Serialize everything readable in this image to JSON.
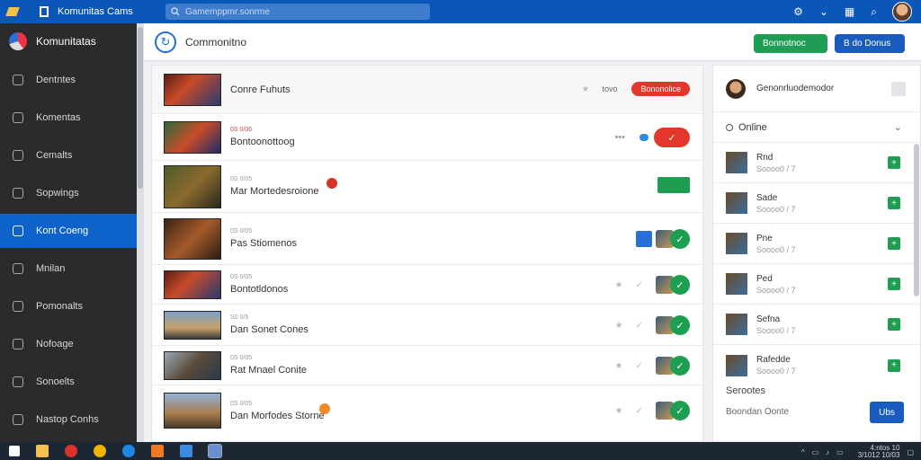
{
  "topbar": {
    "title": "Komunitas Cams",
    "search_placeholder": "Gamemppmr.sonrme",
    "accent": "#0b57b8"
  },
  "sidebar": {
    "header": "Komunitatas",
    "items": [
      {
        "label": "Dentntes",
        "icon": "home-icon"
      },
      {
        "label": "Komentas",
        "icon": "chat-icon"
      },
      {
        "label": "Cemalts",
        "icon": "calendar-icon"
      },
      {
        "label": "Sopwings",
        "icon": "folder-icon"
      },
      {
        "label": "Kont Coeng",
        "icon": "game-icon",
        "active": true
      },
      {
        "label": "Mnilan",
        "icon": "list-icon"
      },
      {
        "label": "Pomonalts",
        "icon": "user-icon"
      },
      {
        "label": "Nofoage",
        "icon": "bookmark-icon"
      },
      {
        "label": "Sonoelts",
        "icon": "search-icon"
      },
      {
        "label": "Nastop Conhs",
        "icon": "globe-icon"
      }
    ]
  },
  "header": {
    "title": "Commonitno",
    "btn_green": "Bonnotnoc",
    "btn_blue": "B do Donus"
  },
  "rows": [
    {
      "meta": "",
      "title": "Conre Fuhuts",
      "action": "Bononolice",
      "action_extra": "tovo"
    },
    {
      "meta": "0S 0/06",
      "title": "Bontoonottoog",
      "action": ""
    },
    {
      "meta": "0S 0/05",
      "title": "Mar Mortedesroione",
      "action": ""
    },
    {
      "meta": "0S 0/05",
      "title": "Pas Stiomenos",
      "action": ""
    },
    {
      "meta": "0S 0/05",
      "title": "Bontotldonos",
      "action": ""
    },
    {
      "meta": "S0 0/5",
      "title": "Dan Sonet Cones",
      "action": ""
    },
    {
      "meta": "0S 0/05",
      "title": "Rat Mnael Conite",
      "action": ""
    },
    {
      "meta": "0S 0/05",
      "title": "Dan Morfodes Storne",
      "action": ""
    }
  ],
  "right_panel": {
    "user": "Genonrluodemodor",
    "online_label": "Online",
    "friends": [
      {
        "name": "Rnd",
        "status": "Soooo0 / 7"
      },
      {
        "name": "Sade",
        "status": "Soooo0 / 7"
      },
      {
        "name": "Pne",
        "status": "Soooo0 / 7"
      },
      {
        "name": "Ped",
        "status": "Soooo0 / 7"
      },
      {
        "name": "Sefna",
        "status": "Soooo0 / 7"
      },
      {
        "name": "Rafedde",
        "status": "Soooo0 / 7"
      }
    ],
    "footer_title": "Serootes",
    "footer_sub": "Boondan Oonte",
    "footer_btn": "Ubs"
  },
  "taskbar": {
    "time": "4:ntos 10",
    "date": "3/1012 10/03"
  }
}
